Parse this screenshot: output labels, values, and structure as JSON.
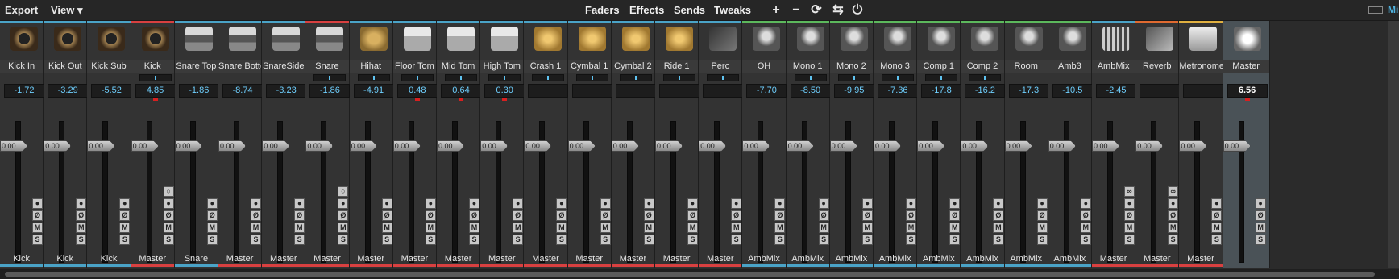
{
  "menus": {
    "export": "Export",
    "view": "View ▾"
  },
  "tabs": [
    {
      "label": "Faders",
      "active": true
    },
    {
      "label": "Effects",
      "active": false
    },
    {
      "label": "Sends",
      "active": false
    },
    {
      "label": "Tweaks",
      "active": false
    }
  ],
  "toolbar": {
    "add": "+",
    "remove": "−",
    "refresh": "⟳",
    "route": "⇆",
    "power": "⏻",
    "edge_label": "Mi"
  },
  "fader_default": "0.00",
  "channels": [
    {
      "name": "Kick In",
      "vol": "-1.72",
      "out": "Kick",
      "icon": "kick-drum-icon",
      "stripe": "#4aa3c7",
      "out_stripe": "#4aa3c7",
      "pan": false,
      "phase_btn": false,
      "red": false
    },
    {
      "name": "Kick Out",
      "vol": "-3.29",
      "out": "Kick",
      "icon": "kick-drum-icon",
      "stripe": "#4aa3c7",
      "out_stripe": "#4aa3c7",
      "pan": false,
      "phase_btn": false,
      "red": false
    },
    {
      "name": "Kick Sub",
      "vol": "-5.52",
      "out": "Kick",
      "icon": "kick-drum-icon",
      "stripe": "#4aa3c7",
      "out_stripe": "#4aa3c7",
      "pan": false,
      "phase_btn": false,
      "red": false
    },
    {
      "name": "Kick",
      "vol": "4.85",
      "out": "Master",
      "icon": "kick-drum-icon",
      "stripe": "#d84040",
      "out_stripe": "#d84040",
      "pan": true,
      "phase_btn": true,
      "red": true
    },
    {
      "name": "Snare Top",
      "vol": "-1.86",
      "out": "Snare",
      "icon": "snare-drum-icon",
      "stripe": "#4aa3c7",
      "out_stripe": "#4aa3c7",
      "pan": false,
      "phase_btn": false,
      "red": false
    },
    {
      "name": "Snare Bottom",
      "vol": "-8.74",
      "out": "Master",
      "icon": "snare-drum-icon",
      "stripe": "#4aa3c7",
      "out_stripe": "#d84040",
      "pan": false,
      "phase_btn": false,
      "red": false
    },
    {
      "name": "SnareSide",
      "vol": "-3.23",
      "out": "Master",
      "icon": "snare-drum-icon",
      "stripe": "#4aa3c7",
      "out_stripe": "#d84040",
      "pan": false,
      "phase_btn": false,
      "red": false
    },
    {
      "name": "Snare",
      "vol": "-1.86",
      "out": "Master",
      "icon": "snare-drum-icon",
      "stripe": "#d84040",
      "out_stripe": "#d84040",
      "pan": true,
      "phase_btn": true,
      "red": false
    },
    {
      "name": "Hihat",
      "vol": "-4.91",
      "out": "Master",
      "icon": "hihat-icon",
      "stripe": "#4aa3c7",
      "out_stripe": "#d84040",
      "pan": true,
      "phase_btn": false,
      "red": false
    },
    {
      "name": "Floor Tom",
      "vol": "0.48",
      "out": "Master",
      "icon": "tom-icon",
      "stripe": "#4aa3c7",
      "out_stripe": "#d84040",
      "pan": true,
      "phase_btn": false,
      "red": true
    },
    {
      "name": "Mid Tom",
      "vol": "0.64",
      "out": "Master",
      "icon": "tom-icon",
      "stripe": "#4aa3c7",
      "out_stripe": "#d84040",
      "pan": true,
      "phase_btn": false,
      "red": true
    },
    {
      "name": "High Tom",
      "vol": "0.30",
      "out": "Master",
      "icon": "tom-icon",
      "stripe": "#4aa3c7",
      "out_stripe": "#d84040",
      "pan": true,
      "phase_btn": false,
      "red": true
    },
    {
      "name": "Crash 1",
      "vol": "",
      "out": "Master",
      "icon": "cymbal-icon",
      "stripe": "#4aa3c7",
      "out_stripe": "#d84040",
      "pan": true,
      "phase_btn": false,
      "red": false
    },
    {
      "name": "Cymbal 1",
      "vol": "",
      "out": "Master",
      "icon": "cymbal-icon",
      "stripe": "#4aa3c7",
      "out_stripe": "#d84040",
      "pan": true,
      "phase_btn": false,
      "red": false
    },
    {
      "name": "Cymbal 2",
      "vol": "",
      "out": "Master",
      "icon": "cymbal-icon",
      "stripe": "#4aa3c7",
      "out_stripe": "#d84040",
      "pan": true,
      "phase_btn": false,
      "red": false
    },
    {
      "name": "Ride 1",
      "vol": "",
      "out": "Master",
      "icon": "cymbal-icon",
      "stripe": "#4aa3c7",
      "out_stripe": "#d84040",
      "pan": true,
      "phase_btn": false,
      "red": false
    },
    {
      "name": "Perc",
      "vol": "",
      "out": "Master",
      "icon": "cowbell-icon",
      "stripe": "#4aa3c7",
      "out_stripe": "#d84040",
      "pan": true,
      "phase_btn": false,
      "red": false
    },
    {
      "name": "OH",
      "vol": "-7.70",
      "out": "AmbMix",
      "icon": "microphone-icon",
      "stripe": "#5cb85c",
      "out_stripe": "#4aa3c7",
      "pan": false,
      "phase_btn": false,
      "red": false
    },
    {
      "name": "Mono 1",
      "vol": "-8.50",
      "out": "AmbMix",
      "icon": "microphone-icon",
      "stripe": "#5cb85c",
      "out_stripe": "#4aa3c7",
      "pan": true,
      "phase_btn": false,
      "red": false
    },
    {
      "name": "Mono 2",
      "vol": "-9.95",
      "out": "AmbMix",
      "icon": "microphone-icon",
      "stripe": "#5cb85c",
      "out_stripe": "#4aa3c7",
      "pan": true,
      "phase_btn": false,
      "red": false
    },
    {
      "name": "Mono 3",
      "vol": "-7.36",
      "out": "AmbMix",
      "icon": "microphone-icon",
      "stripe": "#5cb85c",
      "out_stripe": "#4aa3c7",
      "pan": true,
      "phase_btn": false,
      "red": false
    },
    {
      "name": "Comp 1",
      "vol": "-17.8",
      "out": "AmbMix",
      "icon": "microphone-icon",
      "stripe": "#5cb85c",
      "out_stripe": "#4aa3c7",
      "pan": true,
      "phase_btn": false,
      "red": false
    },
    {
      "name": "Comp 2",
      "vol": "-16.2",
      "out": "AmbMix",
      "icon": "microphone-icon",
      "stripe": "#5cb85c",
      "out_stripe": "#4aa3c7",
      "pan": true,
      "phase_btn": false,
      "red": false
    },
    {
      "name": "Room",
      "vol": "-17.3",
      "out": "AmbMix",
      "icon": "microphone-icon",
      "stripe": "#5cb85c",
      "out_stripe": "#4aa3c7",
      "pan": false,
      "phase_btn": false,
      "red": false
    },
    {
      "name": "Amb3",
      "vol": "-10.5",
      "out": "AmbMix",
      "icon": "microphone-icon",
      "stripe": "#5cb85c",
      "out_stripe": "#4aa3c7",
      "pan": false,
      "phase_btn": false,
      "red": false
    },
    {
      "name": "AmbMix",
      "vol": "-2.45",
      "out": "Master",
      "icon": "mixer-icon",
      "stripe": "#4aa3c7",
      "out_stripe": "#d84040",
      "pan": false,
      "phase_btn": true,
      "red": false
    },
    {
      "name": "Reverb",
      "vol": "",
      "out": "Master",
      "icon": "cable-icon",
      "stripe": "#e06a30",
      "out_stripe": "#d84040",
      "pan": false,
      "phase_btn": true,
      "red": false
    },
    {
      "name": "Metronome",
      "vol": "",
      "out": "Master",
      "icon": "metronome-icon",
      "stripe": "#e0b040",
      "out_stripe": "#d84040",
      "pan": false,
      "phase_btn": false,
      "red": false
    },
    {
      "name": "Master",
      "vol": "6.56",
      "out": "",
      "icon": "reel-icon",
      "stripe": "#4a5257",
      "out_stripe": "#4a5257",
      "pan": false,
      "phase_btn": false,
      "red": true,
      "master": true
    }
  ]
}
